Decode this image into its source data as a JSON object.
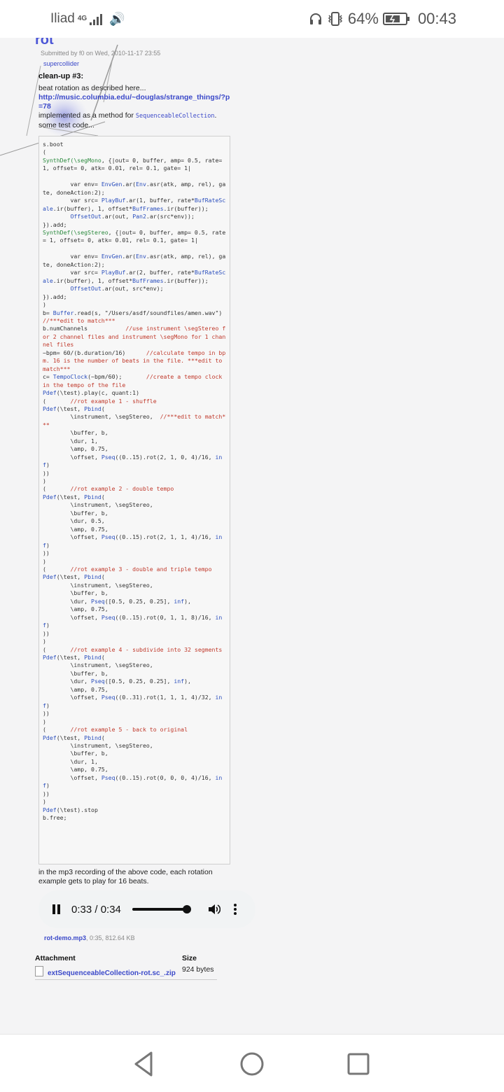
{
  "status_bar": {
    "carrier": "Iliad",
    "network": "4G",
    "battery": "64%",
    "time": "00:43"
  },
  "post": {
    "title": "rot",
    "submitted": "Submitted by f0 on Wed, 2010-11-17 23:55",
    "tag": "supercollider",
    "heading": "clean-up #3:",
    "desc_line1": "beat rotation as described here...",
    "link": "http://music.columbia.edu/~douglas/strange_things/?p=78",
    "desc_impl_prefix": "implemented as a method for ",
    "desc_impl_code": "SequenceableCollection",
    "desc_impl_suffix": ".",
    "desc_line3": "some test code...",
    "after_code": "in the mp3 recording of the above code, each rotation example gets to play for 16 beats."
  },
  "code": [
    [
      [
        "",
        "s.boot"
      ]
    ],
    [
      [
        "",
        "("
      ]
    ],
    [
      [
        "sym",
        "SynthDef(\\segMono"
      ],
      [
        "",
        ", {|out= 0, buffer, amp= 0.5, rate= 1, offset= 0, atk= 0.01, rel= 0.1, gate= 1|"
      ]
    ],
    [
      [
        "",
        ""
      ]
    ],
    [
      [
        "",
        "        var env= "
      ],
      [
        "cls",
        "EnvGen"
      ],
      [
        "",
        ".ar("
      ],
      [
        "cls",
        "Env"
      ],
      [
        "",
        ".asr(atk, amp, rel), gate, doneAction:2);"
      ]
    ],
    [
      [
        "",
        "        var src= "
      ],
      [
        "cls",
        "PlayBuf"
      ],
      [
        "",
        ".ar(1, buffer, rate*"
      ],
      [
        "cls",
        "BufRateScale"
      ],
      [
        "",
        ".ir(buffer), 1, offset*"
      ],
      [
        "cls",
        "BufFrames"
      ],
      [
        "",
        ".ir(buffer));"
      ]
    ],
    [
      [
        "",
        "        "
      ],
      [
        "cls",
        "OffsetOut"
      ],
      [
        "",
        ".ar(out, "
      ],
      [
        "cls",
        "Pan2"
      ],
      [
        "",
        ".ar(src*env));"
      ]
    ],
    [
      [
        "",
        "}).add;"
      ]
    ],
    [
      [
        "sym",
        "SynthDef(\\segStereo"
      ],
      [
        "",
        ", {|out= 0, buffer, amp= 0.5, rate= 1, offset= 0, atk= 0.01, rel= 0.1, gate= 1|"
      ]
    ],
    [
      [
        "",
        ""
      ]
    ],
    [
      [
        "",
        "        var env= "
      ],
      [
        "cls",
        "EnvGen"
      ],
      [
        "",
        ".ar("
      ],
      [
        "cls",
        "Env"
      ],
      [
        "",
        ".asr(atk, amp, rel), gate, doneAction:2);"
      ]
    ],
    [
      [
        "",
        "        var src= "
      ],
      [
        "cls",
        "PlayBuf"
      ],
      [
        "",
        ".ar(2, buffer, rate*"
      ],
      [
        "cls",
        "BufRateScale"
      ],
      [
        "",
        ".ir(buffer), 1, offset*"
      ],
      [
        "cls",
        "BufFrames"
      ],
      [
        "",
        ".ir(buffer));"
      ]
    ],
    [
      [
        "",
        "        "
      ],
      [
        "cls",
        "OffsetOut"
      ],
      [
        "",
        ".ar(out, src*env);"
      ]
    ],
    [
      [
        "",
        "}).add;"
      ]
    ],
    [
      [
        "",
        ")"
      ]
    ],
    [
      [
        "",
        "b= "
      ],
      [
        "cls",
        "Buffer"
      ],
      [
        "",
        ".read(s, \"/Users/asdf/soundfiles/amen.wav\")  "
      ],
      [
        "cmt",
        "//***edit to match***"
      ]
    ],
    [
      [
        "",
        "b.numChannels           "
      ],
      [
        "cmt",
        "//use instrument \\segStereo for 2 channel files and instrument \\segMono for 1 channel files"
      ]
    ],
    [
      [
        "",
        "~bpm= 60/(b.duration/16)      "
      ],
      [
        "cmt",
        "//calculate tempo in bpm. 16 is the number of beats in the file. ***edit to match***"
      ]
    ],
    [
      [
        "",
        "c= "
      ],
      [
        "cls",
        "TempoClock"
      ],
      [
        "",
        "(~bpm/60);       "
      ],
      [
        "cmt",
        "//create a tempo clock in the tempo of the file"
      ]
    ],
    [
      [
        "cls",
        "Pdef"
      ],
      [
        "",
        "(\\test).play(c, quant:1)"
      ]
    ],
    [
      [
        "",
        "(       "
      ],
      [
        "cmt",
        "//rot example 1 - shuffle"
      ]
    ],
    [
      [
        "cls",
        "Pdef"
      ],
      [
        "",
        "(\\test, "
      ],
      [
        "cls",
        "Pbind"
      ],
      [
        "",
        "("
      ]
    ],
    [
      [
        "",
        "        \\instrument, \\segStereo,  "
      ],
      [
        "cmt",
        "//***edit to match***"
      ]
    ],
    [
      [
        "",
        "        \\buffer, b,"
      ]
    ],
    [
      [
        "",
        "        \\dur, 1,"
      ]
    ],
    [
      [
        "",
        "        \\amp, 0.75,"
      ]
    ],
    [
      [
        "",
        "        \\offset, "
      ],
      [
        "cls",
        "Pseq"
      ],
      [
        "",
        "((0..15).rot(2, 1, 0, 4)/16, "
      ],
      [
        "cls",
        "inf"
      ],
      [
        "",
        ")"
      ]
    ],
    [
      [
        "",
        "))"
      ]
    ],
    [
      [
        "",
        ")"
      ]
    ],
    [
      [
        "",
        "(       "
      ],
      [
        "cmt",
        "//rot example 2 - double tempo"
      ]
    ],
    [
      [
        "cls",
        "Pdef"
      ],
      [
        "",
        "(\\test, "
      ],
      [
        "cls",
        "Pbind"
      ],
      [
        "",
        "("
      ]
    ],
    [
      [
        "",
        "        \\instrument, \\segStereo,"
      ]
    ],
    [
      [
        "",
        "        \\buffer, b,"
      ]
    ],
    [
      [
        "",
        "        \\dur, 0.5,"
      ]
    ],
    [
      [
        "",
        "        \\amp, 0.75,"
      ]
    ],
    [
      [
        "",
        "        \\offset, "
      ],
      [
        "cls",
        "Pseq"
      ],
      [
        "",
        "((0..15).rot(2, 1, 1, 4)/16, "
      ],
      [
        "cls",
        "inf"
      ],
      [
        "",
        ")"
      ]
    ],
    [
      [
        "",
        "))"
      ]
    ],
    [
      [
        "",
        ")"
      ]
    ],
    [
      [
        "",
        "(       "
      ],
      [
        "cmt",
        "//rot example 3 - double and triple tempo"
      ]
    ],
    [
      [
        "cls",
        "Pdef"
      ],
      [
        "",
        "(\\test, "
      ],
      [
        "cls",
        "Pbind"
      ],
      [
        "",
        "("
      ]
    ],
    [
      [
        "",
        "        \\instrument, \\segStereo,"
      ]
    ],
    [
      [
        "",
        "        \\buffer, b,"
      ]
    ],
    [
      [
        "",
        "        \\dur, "
      ],
      [
        "cls",
        "Pseq"
      ],
      [
        "",
        "([0.5, 0.25, 0.25], "
      ],
      [
        "cls",
        "inf"
      ],
      [
        "",
        "),"
      ]
    ],
    [
      [
        "",
        "        \\amp, 0.75,"
      ]
    ],
    [
      [
        "",
        "        \\offset, "
      ],
      [
        "cls",
        "Pseq"
      ],
      [
        "",
        "((0..15).rot(0, 1, 1, 8)/16, "
      ],
      [
        "cls",
        "inf"
      ],
      [
        "",
        ")"
      ]
    ],
    [
      [
        "",
        "))"
      ]
    ],
    [
      [
        "",
        ")"
      ]
    ],
    [
      [
        "",
        "(       "
      ],
      [
        "cmt",
        "//rot example 4 - subdivide into 32 segments"
      ]
    ],
    [
      [
        "cls",
        "Pdef"
      ],
      [
        "",
        "(\\test, "
      ],
      [
        "cls",
        "Pbind"
      ],
      [
        "",
        "("
      ]
    ],
    [
      [
        "",
        "        \\instrument, \\segStereo,"
      ]
    ],
    [
      [
        "",
        "        \\buffer, b,"
      ]
    ],
    [
      [
        "",
        "        \\dur, "
      ],
      [
        "cls",
        "Pseq"
      ],
      [
        "",
        "([0.5, 0.25, 0.25], "
      ],
      [
        "cls",
        "inf"
      ],
      [
        "",
        "),"
      ]
    ],
    [
      [
        "",
        "        \\amp, 0.75,"
      ]
    ],
    [
      [
        "",
        "        \\offset, "
      ],
      [
        "cls",
        "Pseq"
      ],
      [
        "",
        "((0..31).rot(1, 1, 1, 4)/32, "
      ],
      [
        "cls",
        "inf"
      ],
      [
        "",
        ")"
      ]
    ],
    [
      [
        "",
        "))"
      ]
    ],
    [
      [
        "",
        ")"
      ]
    ],
    [
      [
        "",
        "(       "
      ],
      [
        "cmt",
        "//rot example 5 - back to original"
      ]
    ],
    [
      [
        "cls",
        "Pdef"
      ],
      [
        "",
        "(\\test, "
      ],
      [
        "cls",
        "Pbind"
      ],
      [
        "",
        "("
      ]
    ],
    [
      [
        "",
        "        \\instrument, \\segStereo,"
      ]
    ],
    [
      [
        "",
        "        \\buffer, b,"
      ]
    ],
    [
      [
        "",
        "        \\dur, 1,"
      ]
    ],
    [
      [
        "",
        "        \\amp, 0.75,"
      ]
    ],
    [
      [
        "",
        "        \\offset, "
      ],
      [
        "cls",
        "Pseq"
      ],
      [
        "",
        "((0..15).rot(0, 0, 0, 4)/16, "
      ],
      [
        "cls",
        "inf"
      ],
      [
        "",
        ")"
      ]
    ],
    [
      [
        "",
        "))"
      ]
    ],
    [
      [
        "",
        ")"
      ]
    ],
    [
      [
        "cls",
        "Pdef"
      ],
      [
        "",
        "(\\test).stop"
      ]
    ],
    [
      [
        "",
        "b.free;"
      ]
    ]
  ],
  "player": {
    "time": "0:33 / 0:34",
    "progress": 0.97,
    "state": "playing"
  },
  "audio_file": {
    "name": "rot-demo.mp3",
    "meta": ", 0:35, 812.64 KB"
  },
  "attachments": {
    "col_attachment": "Attachment",
    "col_size": "Size",
    "rows": [
      {
        "name": "extSequenceableCollection-rot.sc_.zip",
        "size": "924 bytes"
      }
    ]
  },
  "icons": {
    "volume": "volume-icon",
    "pause": "pause-icon",
    "more": "more-vert-icon",
    "file": "file-icon",
    "headset": "headset-icon",
    "vibrate": "vibrate-icon",
    "battery": "battery-icon",
    "nav_back": "nav-back-icon",
    "nav_home": "nav-home-icon",
    "nav_recent": "nav-recent-icon"
  },
  "colors": {
    "link": "#3b49c9",
    "title": "#4b55d6",
    "code_class": "#2b4fbd",
    "code_symbol": "#2b8a3e",
    "code_comment": "#c0392b"
  }
}
